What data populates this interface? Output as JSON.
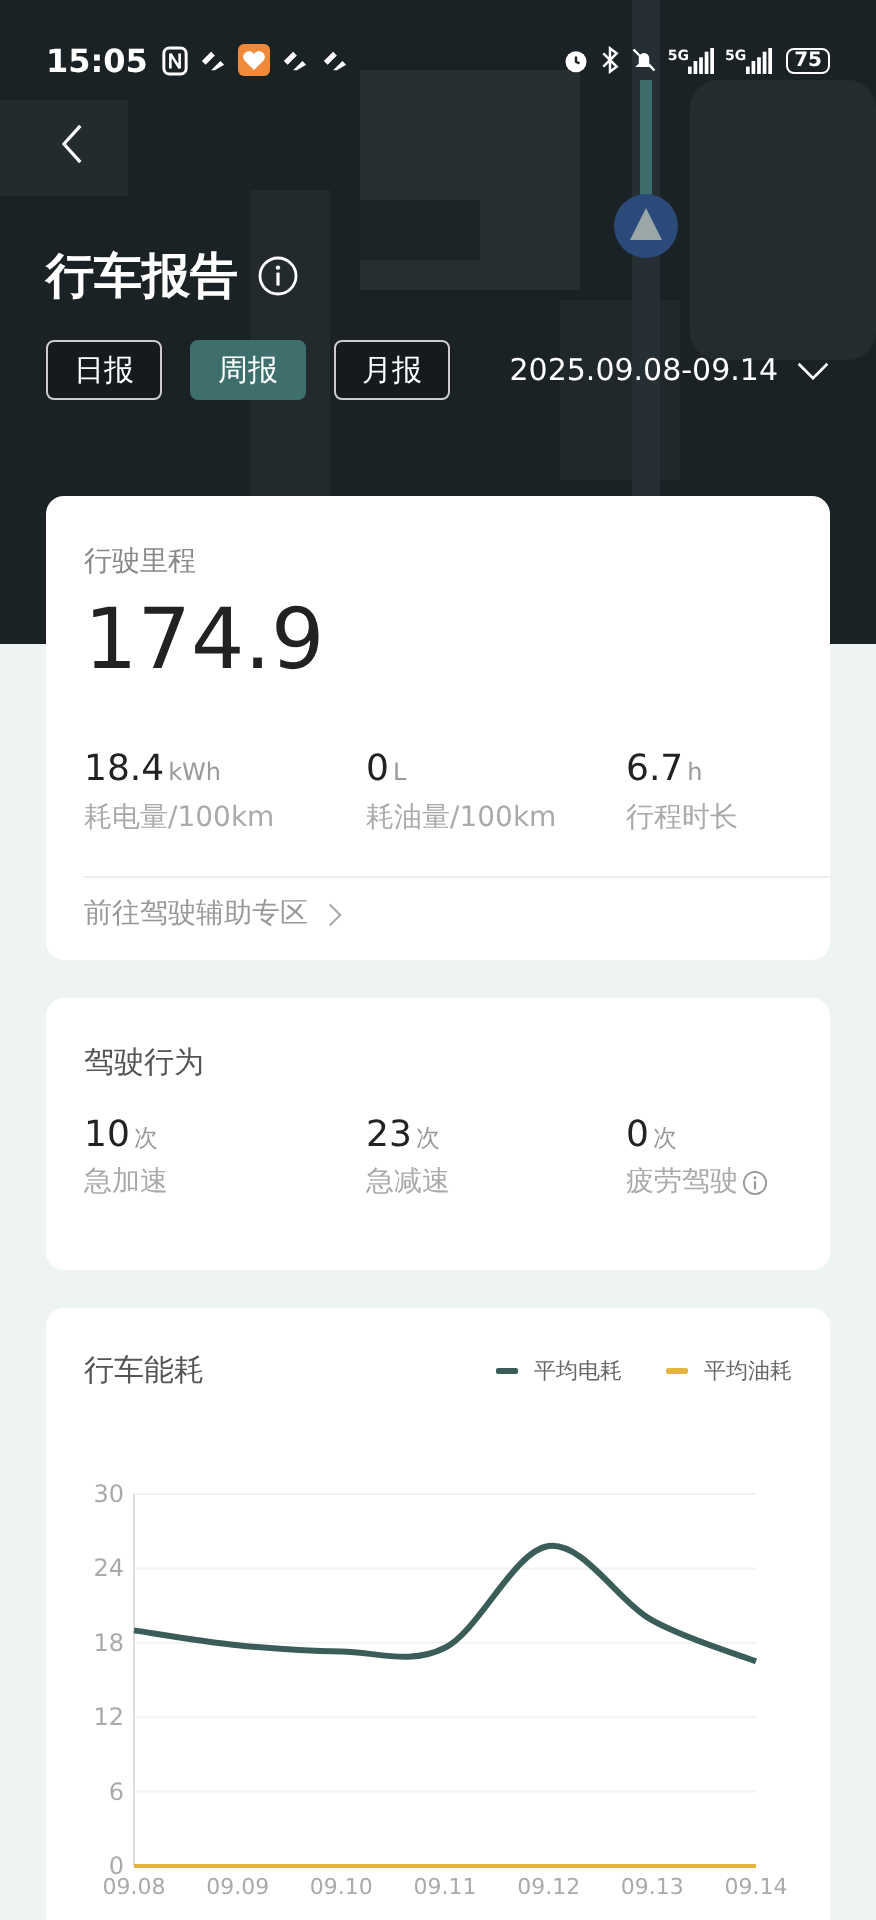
{
  "status_bar": {
    "time": "15:05",
    "network_labels": [
      "5G",
      "5G"
    ],
    "battery": "75"
  },
  "title": "行车报告",
  "period_tabs": [
    {
      "label": "日报",
      "selected": false
    },
    {
      "label": "周报",
      "selected": true
    },
    {
      "label": "月报",
      "selected": false
    }
  ],
  "date_range": "2025.09.08-09.14",
  "mileage": {
    "label": "行驶里程",
    "value": "174.9",
    "stats": [
      {
        "value": "18.4",
        "unit": "kWh",
        "label": "耗电量/100km"
      },
      {
        "value": "0",
        "unit": "L",
        "label": "耗油量/100km"
      },
      {
        "value": "6.7",
        "unit": "h",
        "label": "行程时长"
      }
    ],
    "link": "前往驾驶辅助专区"
  },
  "behavior": {
    "title": "驾驶行为",
    "items": [
      {
        "value": "10",
        "unit": "次",
        "label": "急加速",
        "info": false
      },
      {
        "value": "23",
        "unit": "次",
        "label": "急减速",
        "info": false
      },
      {
        "value": "0",
        "unit": "次",
        "label": "疲劳驾驶",
        "info": true
      }
    ]
  },
  "energy": {
    "title": "行车能耗",
    "chart_data": {
      "type": "line",
      "grid": true,
      "categories": [
        "09.08",
        "09.09",
        "09.10",
        "09.11",
        "09.12",
        "09.13",
        "09.14"
      ],
      "ylim": [
        0,
        30
      ],
      "yticks": [
        0,
        6,
        12,
        18,
        24,
        30
      ],
      "series": [
        {
          "name": "平均电耗",
          "color": "#3b5d5a",
          "values": [
            19.0,
            17.8,
            17.3,
            17.6,
            25.8,
            19.8,
            16.5
          ]
        },
        {
          "name": "平均油耗",
          "color": "#e3b441",
          "values": [
            0,
            0,
            0,
            0,
            0,
            0,
            0
          ]
        }
      ]
    }
  }
}
